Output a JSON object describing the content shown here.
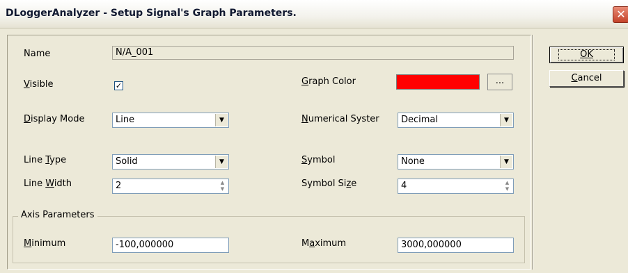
{
  "window": {
    "title": "DLoggerAnalyzer - Setup Signal's Graph Parameters.",
    "close_icon": "close-icon"
  },
  "form": {
    "name_label": "Name",
    "name_value": "N/A_001",
    "visible_label": "Visible",
    "visible_checked": true,
    "graph_color_label": "Graph Color",
    "graph_color_value": "#ff0000",
    "graph_color_button": "...",
    "display_mode_label": "Display Mode",
    "display_mode_value": "Line",
    "numerical_system_label": "Numerical Syster",
    "numerical_system_value": "Decimal",
    "line_type_label": "Line Type",
    "line_type_value": "Solid",
    "symbol_label": "Symbol",
    "symbol_value": "None",
    "line_width_label": "Line Width",
    "line_width_value": "2",
    "symbol_size_label": "Symbol Size",
    "symbol_size_value": "4"
  },
  "axis": {
    "group_label": "Axis Parameters",
    "minimum_label": "Minimum",
    "minimum_value": "-100,000000",
    "maximum_label": "Maximum",
    "maximum_value": "3000,000000"
  },
  "buttons": {
    "ok_label": "OK",
    "cancel_label": "Cancel"
  }
}
